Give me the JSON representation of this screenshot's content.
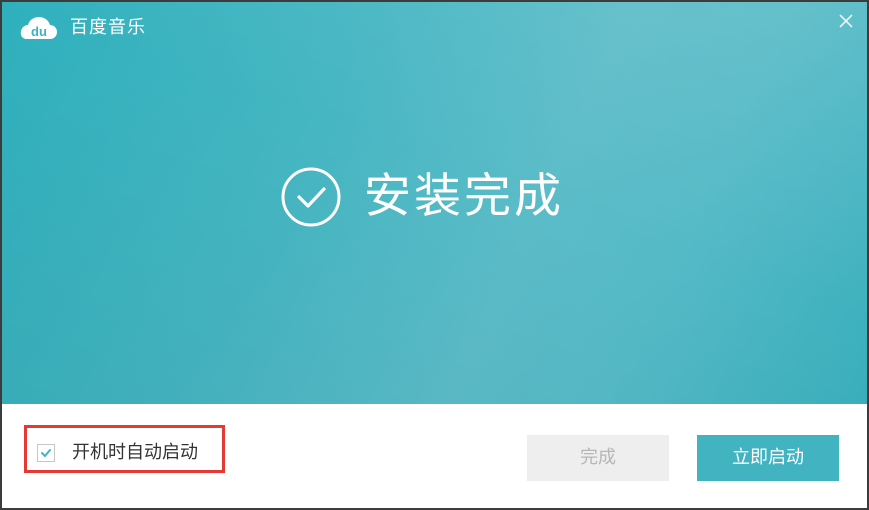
{
  "window": {
    "app_title": "百度音乐",
    "logo_text": "du",
    "close_icon": "close-icon"
  },
  "status": {
    "icon": "check-circle-icon",
    "text": "安装完成"
  },
  "footer": {
    "autostart": {
      "label": "开机时自动启动",
      "checked": true
    },
    "finish_button": {
      "label": "完成",
      "enabled": false
    },
    "launch_button": {
      "label": "立即启动"
    }
  },
  "colors": {
    "accent": "#41b3c1",
    "highlight_border": "#e53935",
    "disabled_text": "#b6b6b6"
  }
}
